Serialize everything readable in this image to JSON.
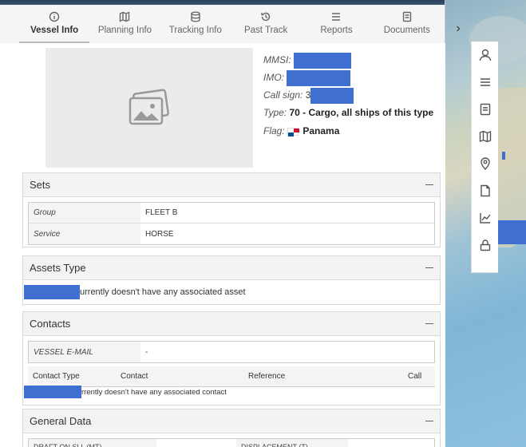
{
  "tabs": [
    {
      "label": "Vessel Info",
      "icon": "info-icon",
      "active": true
    },
    {
      "label": "Planning Info",
      "icon": "map-icon",
      "active": false
    },
    {
      "label": "Tracking Info",
      "icon": "database-icon",
      "active": false
    },
    {
      "label": "Past Track",
      "icon": "history-icon",
      "active": false
    },
    {
      "label": "Reports",
      "icon": "list-icon",
      "active": false
    },
    {
      "label": "Documents",
      "icon": "document-icon",
      "active": false
    }
  ],
  "vessel": {
    "mmsi_label": "MMSI:",
    "imo_label": "IMO:",
    "callsign_label": "Call sign:",
    "callsign_prefix": "3",
    "type_label": "Type:",
    "type_value": "70 - Cargo, all ships of this type",
    "flag_label": "Flag:",
    "flag_value": "Panama"
  },
  "sets": {
    "title": "Sets",
    "rows": [
      {
        "key": "Group",
        "value": "FLEET B"
      },
      {
        "key": "Service",
        "value": "HORSE"
      }
    ]
  },
  "assets": {
    "title": "Assets Type",
    "message": "urrently doesn't have any associated asset"
  },
  "contacts": {
    "title": "Contacts",
    "email_key": "VESSEL E-MAIL",
    "email_value": "-",
    "columns": [
      "Contact Type",
      "Contact",
      "Reference",
      "Call"
    ],
    "message": "rrently doesn't have any associated contact"
  },
  "general": {
    "title": "General Data",
    "col1": "DRAFT ON SLL (MT)",
    "col2": "DISPLACEMENT (T)"
  },
  "colors": {
    "redaction": "#3f6fd1",
    "header_bar": "#2a3f5c"
  },
  "toolbar_icons": [
    "user-icon",
    "list-icon",
    "document-icon",
    "map-icon",
    "location-pin-icon",
    "file-icon",
    "chart-icon",
    "lock-icon"
  ]
}
